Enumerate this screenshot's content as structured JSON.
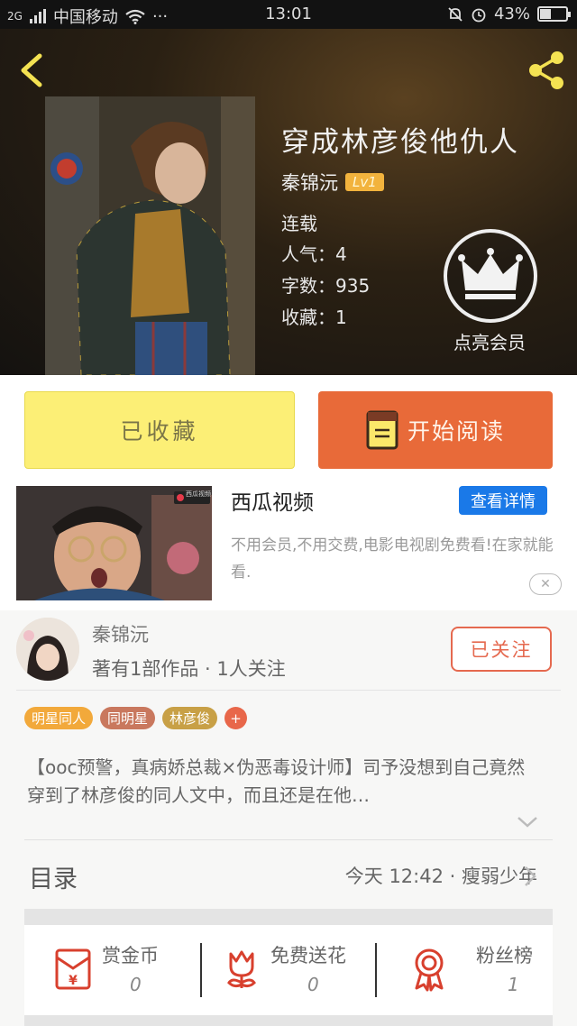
{
  "status_bar": {
    "network": "2G",
    "carrier": "中国移动",
    "more": "···",
    "time": "13:01",
    "battery": "43%",
    "battery_level": 0.43
  },
  "book": {
    "title": "穿成林彦俊他仇人",
    "author": "秦锦沅",
    "level": "Lv1",
    "status": "连载",
    "popularity": "人气：4",
    "word_count": "字数：935",
    "favorites": "收藏：1",
    "vip_label": "点亮会员"
  },
  "actions": {
    "collected": "已收藏",
    "start_reading": "开始阅读"
  },
  "ad": {
    "title": "西瓜视频",
    "detail_button": "查看详情",
    "description": "不用会员,不用交费,电影电视剧免费看!在家就能看.",
    "image_watermark": "西瓜视频",
    "close": "✕"
  },
  "author_card": {
    "name": "秦锦沅",
    "summary": "著有1部作品 · 1人关注",
    "follow_button": "已关注"
  },
  "tags": [
    {
      "label": "明星同人",
      "color": "#f2a93b"
    },
    {
      "label": "同明星",
      "color": "#c9785e"
    },
    {
      "label": "林彦俊",
      "color": "#c8a046"
    }
  ],
  "tag_add": "+",
  "synopsis": "【ooc预警，真病娇总裁×伪恶毒设计师】司予没想到自己竟然穿到了林彦俊的同人文中，而且还是在他…",
  "toc": {
    "label": "目录",
    "latest": "今天 12:42 · 瘦弱少年"
  },
  "stats": [
    {
      "label": "赏金币",
      "value": "0",
      "icon": "red-envelope-icon"
    },
    {
      "label": "免费送花",
      "value": "0",
      "icon": "flower-icon"
    },
    {
      "label": "粉丝榜",
      "value": "1",
      "icon": "award-ribbon-icon"
    }
  ],
  "colors": {
    "accent_orange": "#e86a39",
    "collect_yellow": "#fcef76",
    "ad_blue": "#1a79e8",
    "follow_red": "#e5694f",
    "level_badge": "#f2b33d"
  }
}
